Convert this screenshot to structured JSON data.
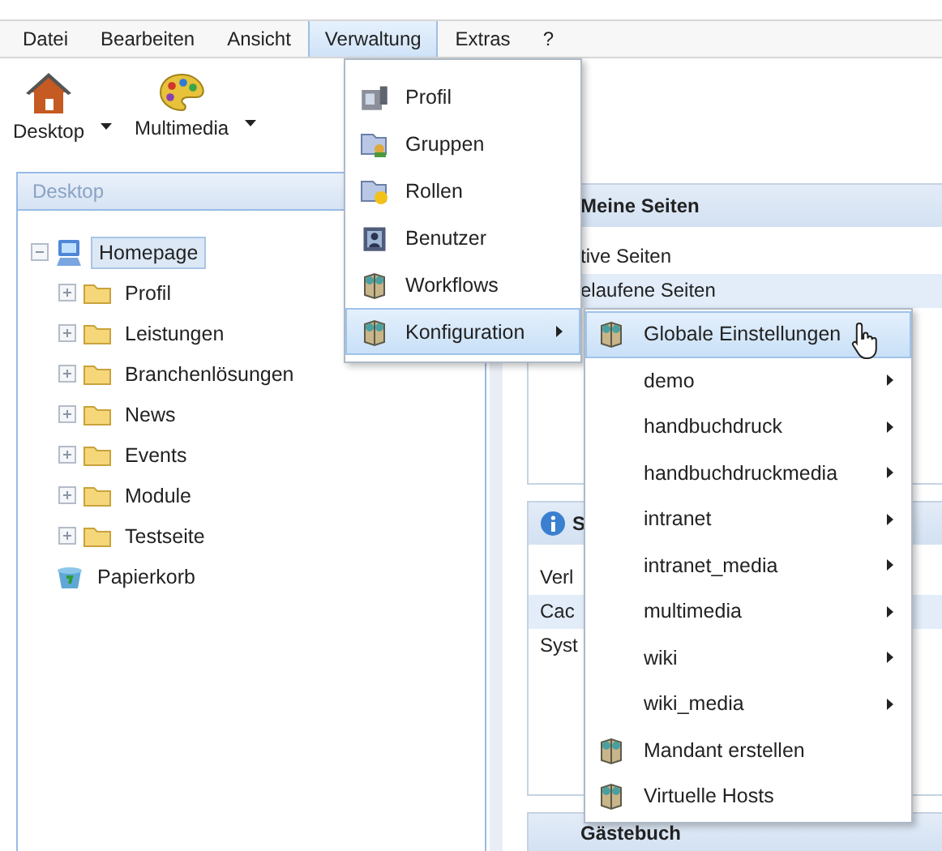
{
  "menu_bar": [
    {
      "label": "Datei",
      "selected": false
    },
    {
      "label": "Bearbeiten",
      "selected": false
    },
    {
      "label": "Ansicht",
      "selected": false
    },
    {
      "label": "Verwaltung",
      "selected": true
    },
    {
      "label": "Extras",
      "selected": false
    },
    {
      "label": "?",
      "selected": false
    }
  ],
  "toolbar": [
    {
      "label": "Desktop",
      "kind": "house"
    },
    {
      "label": "Multimedia",
      "kind": "palette"
    }
  ],
  "sidebar": {
    "title": "Desktop",
    "tree": [
      {
        "label": "Homepage",
        "kind": "site",
        "expanded": true,
        "selected": true,
        "children": [
          {
            "label": "Profil",
            "kind": "folder",
            "expanded": false,
            "selected": false
          },
          {
            "label": "Leistungen",
            "kind": "folder",
            "expanded": false,
            "selected": false
          },
          {
            "label": "Branchenlösungen",
            "kind": "folder",
            "expanded": false,
            "selected": false
          },
          {
            "label": "News",
            "kind": "folder",
            "expanded": false,
            "selected": false
          },
          {
            "label": "Events",
            "kind": "folder",
            "expanded": false,
            "selected": false
          },
          {
            "label": "Module",
            "kind": "folder",
            "expanded": false,
            "selected": false
          },
          {
            "label": "Testseite",
            "kind": "folder",
            "expanded": false,
            "selected": false
          }
        ]
      },
      {
        "label": "Papierkorb",
        "kind": "trash",
        "selected": false
      }
    ]
  },
  "panels": [
    {
      "title": "Meine Seiten",
      "kind": "plain",
      "rows": [
        {
          "text": "tive Seiten",
          "selected": false
        },
        {
          "text": "elaufene Seiten",
          "selected": true
        }
      ]
    },
    {
      "title": "S",
      "kind": "info",
      "rows": [
        {
          "text": "Verl",
          "selected": false
        },
        {
          "text": "Cac",
          "selected": true
        },
        {
          "text": "Syst",
          "selected": false
        }
      ]
    },
    {
      "title": "Gästebuch",
      "kind": "plain"
    }
  ],
  "menu": {
    "items": [
      {
        "label": "Profil",
        "kind": "profile",
        "submenu": false,
        "selected": false
      },
      {
        "label": "Gruppen",
        "kind": "group",
        "submenu": false,
        "selected": false
      },
      {
        "label": "Rollen",
        "kind": "role",
        "submenu": false,
        "selected": false
      },
      {
        "label": "Benutzer",
        "kind": "user",
        "submenu": false,
        "selected": false
      },
      {
        "label": "Workflows",
        "kind": "config",
        "submenu": false,
        "selected": false
      },
      {
        "label": "Konfiguration",
        "kind": "config",
        "submenu": true,
        "selected": true
      }
    ]
  },
  "submenu": {
    "items": [
      {
        "label": "Globale Einstellungen",
        "kind": "config",
        "submenu": false,
        "selected": true
      },
      {
        "label": "demo",
        "kind": "plain",
        "submenu": true,
        "selected": false
      },
      {
        "label": "handbuchdruck",
        "kind": "plain",
        "submenu": true,
        "selected": false
      },
      {
        "label": "handbuchdruckmedia",
        "kind": "plain",
        "submenu": true,
        "selected": false
      },
      {
        "label": "intranet",
        "kind": "plain",
        "submenu": true,
        "selected": false
      },
      {
        "label": "intranet_media",
        "kind": "plain",
        "submenu": true,
        "selected": false
      },
      {
        "label": "multimedia",
        "kind": "plain",
        "submenu": true,
        "selected": false
      },
      {
        "label": "wiki",
        "kind": "plain",
        "submenu": true,
        "selected": false
      },
      {
        "label": "wiki_media",
        "kind": "plain",
        "submenu": true,
        "selected": false
      },
      {
        "label": "Mandant erstellen",
        "kind": "config",
        "submenu": false,
        "selected": false
      },
      {
        "label": "Virtuelle Hosts",
        "kind": "config",
        "submenu": false,
        "selected": false
      }
    ]
  }
}
